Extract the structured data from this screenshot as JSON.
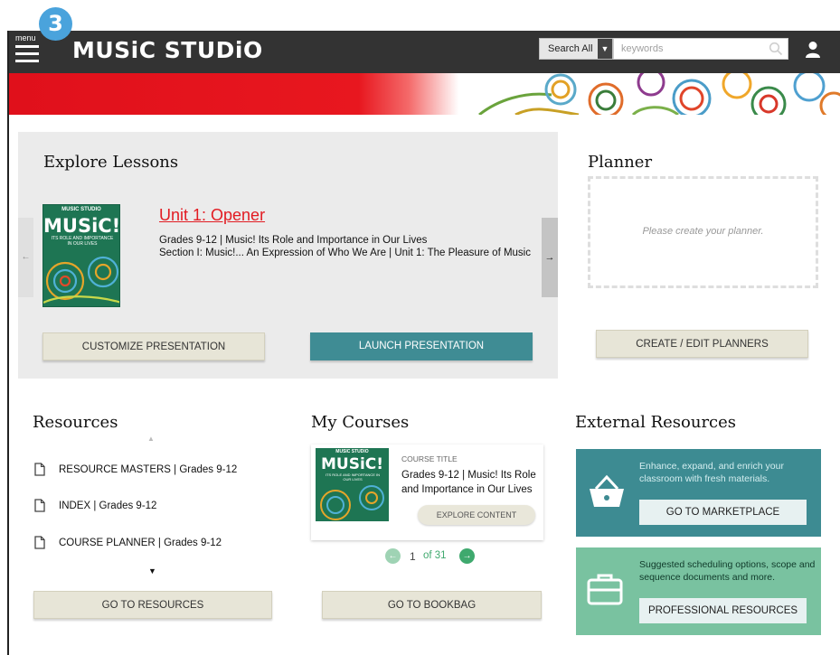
{
  "step_badge": "3",
  "header": {
    "menu_label": "menu",
    "logo": "MUSiC STUDiO",
    "search_scope": "Search All",
    "search_placeholder": "keywords"
  },
  "explore": {
    "title": "Explore Lessons",
    "book_top": "MUSIC STUDIO",
    "book_title": "MUSiC!",
    "book_subtitle": "ITS ROLE AND IMPORTANCE IN OUR LIVES",
    "unit_link": "Unit 1: Opener",
    "line1": "Grades 9-12 | Music! Its Role and Importance in Our Lives",
    "line2": "Section I: Music!... An Expression of Who We Are | Unit 1: The Pleasure of Music",
    "customize_btn": "CUSTOMIZE PRESENTATION",
    "launch_btn": "LAUNCH PRESENTATION"
  },
  "planner": {
    "title": "Planner",
    "empty_text": "Please create your planner.",
    "create_btn": "CREATE / EDIT PLANNERS"
  },
  "resources": {
    "title": "Resources",
    "items": [
      {
        "label": "RESOURCE MASTERS | Grades 9-12"
      },
      {
        "label": "INDEX | Grades 9-12"
      },
      {
        "label": "COURSE PLANNER | Grades 9-12"
      }
    ],
    "go_btn": "GO TO RESOURCES"
  },
  "courses": {
    "title": "My Courses",
    "card_label": "COURSE TITLE",
    "card_name": "Grades 9-12 | Music! Its Role and Importance in Our Lives",
    "explore_btn": "EXPLORE CONTENT",
    "page_current": "1",
    "page_of": "of 31",
    "bookbag_btn": "GO TO BOOKBAG"
  },
  "external": {
    "title": "External Resources",
    "marketplace_text": "Enhance, expand, and enrich your classroom with fresh materials.",
    "marketplace_btn": "GO TO MARKETPLACE",
    "professional_text": "Suggested scheduling options, scope and sequence documents and more.",
    "professional_btn": "PROFESSIONAL RESOURCES"
  },
  "colors": {
    "topbar": "#333333",
    "brand_red": "#e0101b",
    "teal": "#3f8c94",
    "mint": "#79c2a0",
    "link_red": "#e21b22"
  }
}
